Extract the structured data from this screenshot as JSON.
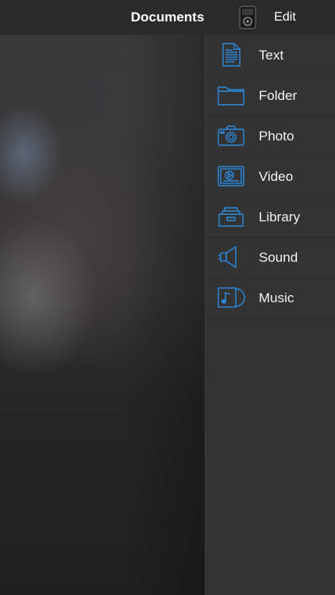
{
  "header": {
    "title": "Documents",
    "edit_label": "Edit",
    "device_icon": "ipod-icon"
  },
  "menu": {
    "accent_color": "#2b8ce0",
    "items": [
      {
        "label": "Text",
        "icon": "text-document-icon"
      },
      {
        "label": "Folder",
        "icon": "folder-icon"
      },
      {
        "label": "Photo",
        "icon": "camera-icon"
      },
      {
        "label": "Video",
        "icon": "video-icon"
      },
      {
        "label": "Library",
        "icon": "library-icon"
      },
      {
        "label": "Sound",
        "icon": "speaker-icon"
      },
      {
        "label": "Music",
        "icon": "music-album-icon"
      }
    ]
  }
}
